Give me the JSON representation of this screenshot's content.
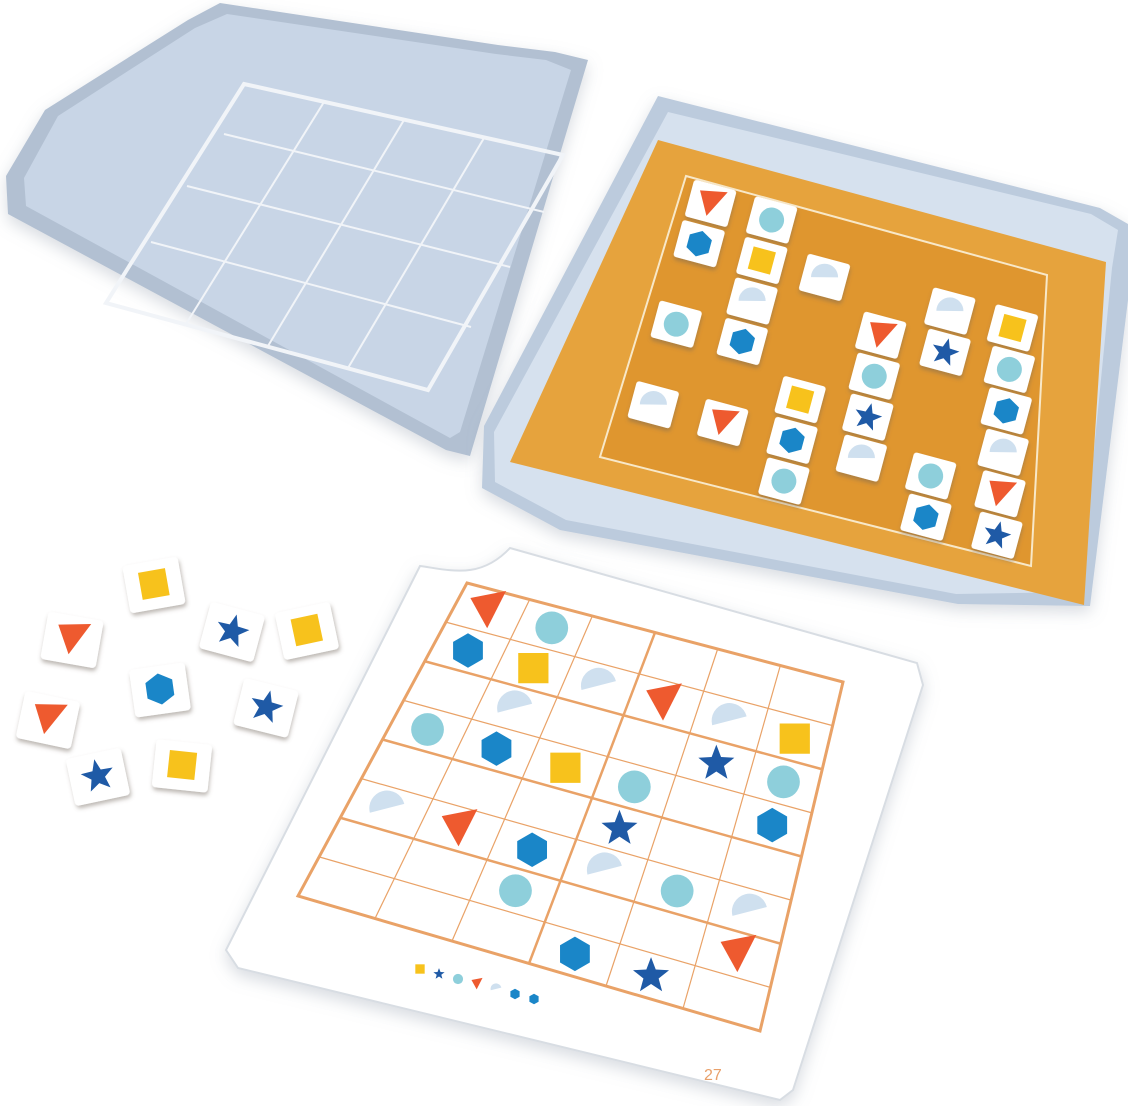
{
  "card": {
    "page_number": "27"
  },
  "shape_set": [
    "square",
    "star",
    "circle",
    "triangle",
    "half-circle",
    "hexagon"
  ],
  "colors": {
    "square": "#f7c21c",
    "star": "#1f5aa6",
    "circle": "#8ecfdb",
    "triangle": "#ee5a2f",
    "half-circle": "#cfe0ef",
    "hexagon": "#1a86c8",
    "grid_line": "#e9a267",
    "tray_tan": "#e6a33d",
    "tin_blue": "#c6d4e5"
  },
  "tray_board": [
    [
      "triangle",
      "circle",
      "",
      "",
      "",
      ""
    ],
    [
      "hexagon",
      "square",
      "half-circle",
      "",
      "half-circle",
      "square"
    ],
    [
      "",
      "half-circle",
      "",
      "triangle",
      "star",
      "circle"
    ],
    [
      "circle",
      "hexagon",
      "",
      "circle",
      "",
      "hexagon"
    ],
    [
      "",
      "",
      "square",
      "star",
      "",
      "half-circle"
    ],
    [
      "half-circle",
      "triangle",
      "hexagon",
      "half-circle",
      "circle",
      "triangle"
    ],
    [
      "",
      "",
      "circle",
      "",
      "hexagon",
      "star"
    ]
  ],
  "card_puzzle": [
    [
      "triangle",
      "circle",
      "",
      "",
      "",
      ""
    ],
    [
      "hexagon",
      "square",
      "half-circle",
      "triangle",
      "half-circle",
      "square"
    ],
    [
      "",
      "half-circle",
      "",
      "",
      "star",
      "circle"
    ],
    [
      "circle",
      "hexagon",
      "square",
      "circle",
      "",
      "hexagon"
    ],
    [
      "",
      "",
      "",
      "star",
      "",
      ""
    ],
    [
      "half-circle",
      "triangle",
      "hexagon",
      "half-circle",
      "circle",
      "half-circle"
    ],
    [
      "",
      "",
      "circle",
      "",
      "",
      "triangle"
    ],
    [
      "",
      "",
      "",
      "hexagon",
      "star",
      ""
    ]
  ],
  "loose_tiles": [
    "square",
    "triangle",
    "star",
    "square",
    "hexagon",
    "triangle",
    "star",
    "star",
    "square"
  ]
}
